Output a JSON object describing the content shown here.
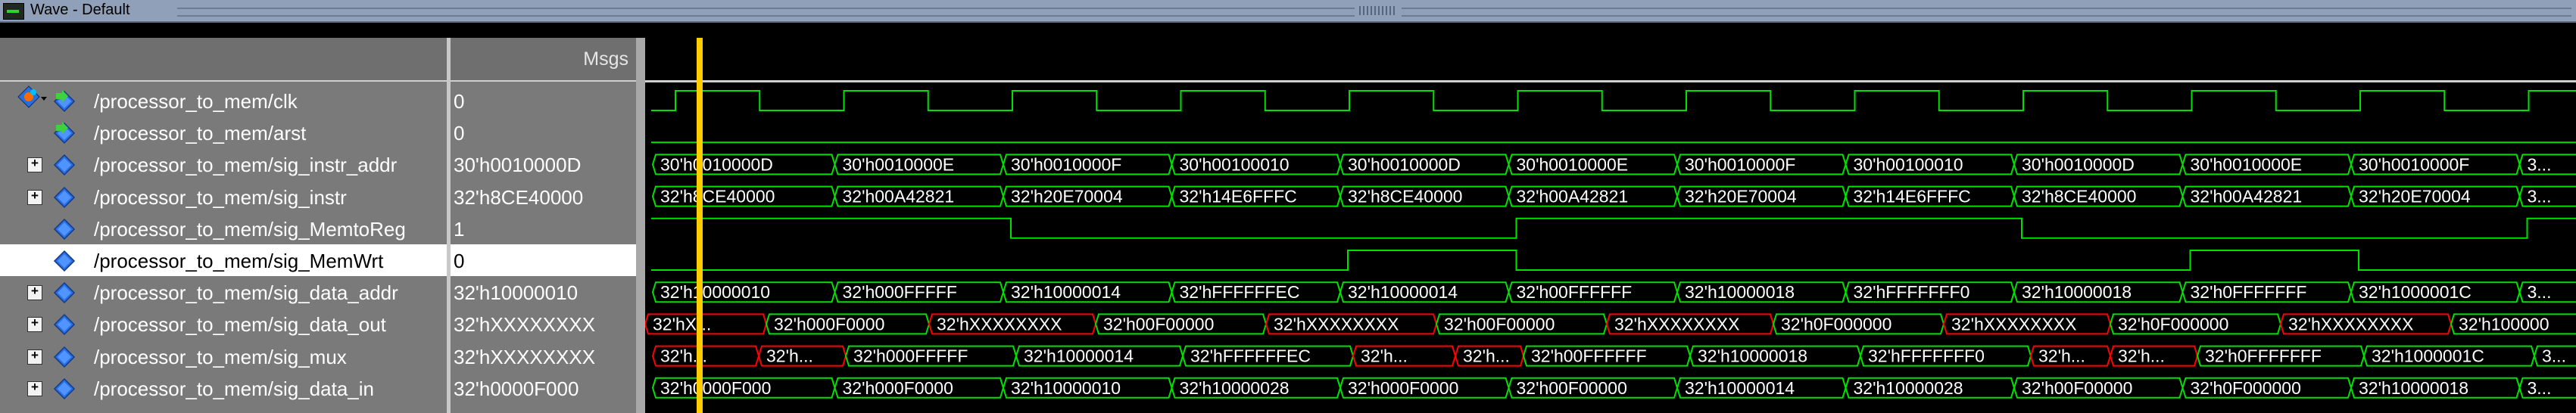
{
  "window": {
    "title": "Wave - Default"
  },
  "header": {
    "msgs_label": "Msgs",
    "toolbar_icon": "signal-diamond-icon"
  },
  "colors": {
    "wave": "#00e000",
    "undefined": "#ff0000",
    "cursor": "#ffcc00",
    "wave_bg": "#000000",
    "pane_bg": "#7a7a7a"
  },
  "signals": [
    {
      "name": "/processor_to_mem/clk",
      "value": "0",
      "kind": "clock",
      "expandable": false,
      "icon": "input-signal-icon"
    },
    {
      "name": "/processor_to_mem/arst",
      "value": "0",
      "kind": "reset",
      "expandable": false,
      "icon": "input-signal-icon"
    },
    {
      "name": "/processor_to_mem/sig_instr_addr",
      "value": "30'h0010000D",
      "kind": "bus",
      "expandable": true,
      "icon": "bus-signal-icon"
    },
    {
      "name": "/processor_to_mem/sig_instr",
      "value": "32'h8CE40000",
      "kind": "bus",
      "expandable": true,
      "icon": "bus-signal-icon"
    },
    {
      "name": "/processor_to_mem/sig_MemtoReg",
      "value": "1",
      "kind": "bit",
      "expandable": false,
      "icon": "signal-icon"
    },
    {
      "name": "/processor_to_mem/sig_MemWrt",
      "value": "0",
      "kind": "bit",
      "expandable": false,
      "icon": "signal-icon",
      "selected": true
    },
    {
      "name": "/processor_to_mem/sig_data_addr",
      "value": "32'h10000010",
      "kind": "bus",
      "expandable": true,
      "icon": "bus-signal-icon"
    },
    {
      "name": "/processor_to_mem/sig_data_out",
      "value": "32'hXXXXXXXX",
      "kind": "bus",
      "expandable": true,
      "icon": "bus-signal-icon"
    },
    {
      "name": "/processor_to_mem/sig_mux",
      "value": "32'hXXXXXXXX",
      "kind": "bus",
      "expandable": true,
      "icon": "bus-signal-icon"
    },
    {
      "name": "/processor_to_mem/sig_data_in",
      "value": "32'h0000F000",
      "kind": "bus",
      "expandable": true,
      "icon": "bus-signal-icon"
    }
  ],
  "waves": {
    "clk": {
      "initial": "low",
      "note": "period one segment, toggles every half segment"
    },
    "arst": {
      "level": "low"
    },
    "sig_MemtoReg": {
      "levels": [
        1,
        1,
        0,
        0,
        0,
        1,
        1,
        1,
        0,
        0,
        0,
        1,
        1,
        1,
        0,
        0
      ]
    },
    "sig_MemWrt": {
      "levels": [
        0,
        0,
        0,
        0,
        1,
        0,
        0,
        0,
        0,
        1,
        0,
        0,
        0,
        0,
        1,
        0
      ]
    },
    "sig_instr_addr": [
      "30'h0010000D",
      "30'h0010000E",
      "30'h0010000F",
      "30'h00100010",
      "30'h0010000D",
      "30'h0010000E",
      "30'h0010000F",
      "30'h00100010",
      "30'h0010000D",
      "30'h0010000E",
      "30'h0010000F",
      "3..."
    ],
    "sig_instr": [
      "32'h8CE40000",
      "32'h00A42821",
      "32'h20E70004",
      "32'h14E6FFFC",
      "32'h8CE40000",
      "32'h00A42821",
      "32'h20E70004",
      "32'h14E6FFFC",
      "32'h8CE40000",
      "32'h00A42821",
      "32'h20E70004",
      "3..."
    ],
    "sig_data_addr": [
      "32'h10000010",
      "32'h000FFFFF",
      "32'h10000014",
      "32'hFFFFFFEC",
      "32'h10000014",
      "32'h00FFFFFF",
      "32'h10000018",
      "32'hFFFFFFF0",
      "32'h10000018",
      "32'h0FFFFFFF",
      "32'h1000001C",
      "3..."
    ],
    "sig_data_out": [
      "32'hX...",
      "32'h000F0000",
      "32'hXXXXXXXX",
      "32'h00F00000",
      "32'hXXXXXXXX",
      "32'h00F00000",
      "32'hXXXXXXXX",
      "32'h0F000000",
      "32'hXXXXXXXX",
      "32'h0F000000",
      "32'hXXXXXXXX",
      "32'h100000"
    ],
    "sig_mux": [
      "32'h...",
      "32'h...",
      "32'h000FFFFF",
      "32'h10000014",
      "32'hFFFFFFEC",
      "32'h...",
      "32'h...",
      "32'h00FFFFFF",
      "32'h10000018",
      "32'hFFFFFFF0",
      "32'h...",
      "32'h...",
      "32'h0FFFFFFF",
      "32'h1000001C",
      "3..."
    ],
    "sig_data_in": [
      "32'h0000F000",
      "32'h000F0000",
      "32'h10000010",
      "32'h10000028",
      "32'h000F0000",
      "32'h00F00000",
      "32'h10000014",
      "32'h10000028",
      "32'h00F00000",
      "32'h0F000000",
      "32'h10000018",
      "3..."
    ],
    "data_out_prefix": "32'h",
    "mux_undefined_slots": [
      0,
      1,
      5,
      6,
      10,
      11
    ]
  }
}
